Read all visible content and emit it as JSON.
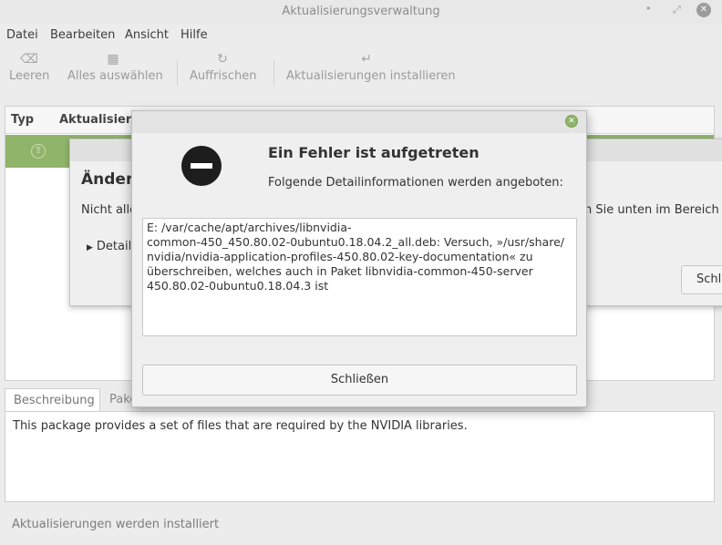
{
  "window": {
    "title": "Aktualisierungsverwaltung",
    "controls": {
      "minimize": "•",
      "maximize": "⤢",
      "close": "✕"
    }
  },
  "menubar": {
    "datei": "Datei",
    "bearbeiten": "Bearbeiten",
    "ansicht": "Ansicht",
    "hilfe": "Hilfe"
  },
  "toolbar": {
    "leeren": {
      "label": "Leeren",
      "icon": "⌫"
    },
    "alle": {
      "label": "Alles auswählen",
      "icon": "▦"
    },
    "auffrischen": {
      "label": "Auffrischen",
      "icon": "↻"
    },
    "installieren": {
      "label": "Aktualisierungen installieren",
      "icon": "↵"
    }
  },
  "list": {
    "columns": {
      "typ": "Typ",
      "aktualisierung": "Aktualisierung"
    },
    "row_icon": "⇧"
  },
  "tabs": {
    "beschreibung": "Beschreibung",
    "paket": "Paket"
  },
  "description": "This package provides a set of files that are required by the NVIDIA libraries.",
  "status": "Aktualisierungen werden installiert",
  "background_dialog": {
    "title": "Änderu",
    "text": "Nicht alle",
    "text_right": "n Sie unten im Bereich »D",
    "details": "Details",
    "close": "Schli"
  },
  "error_dialog": {
    "title": "Ein Fehler ist aufgetreten",
    "subtitle": "Folgende Detailinformationen werden angeboten:",
    "detail": "E: /var/cache/apt/archives/libnvidia-\ncommon-450_450.80.02-0ubuntu0.18.04.2_all.deb: Versuch, »/usr/share/\nnvidia/nvidia-application-profiles-450.80.02-key-documentation« zu\nüberschreiben, welches auch in Paket libnvidia-common-450-server\n450.80.02-0ubuntu0.18.04.3 ist",
    "close": "Schließen",
    "close_icon": "✕"
  },
  "colors": {
    "accent_green": "#8fb46a",
    "background": "#ececec"
  }
}
